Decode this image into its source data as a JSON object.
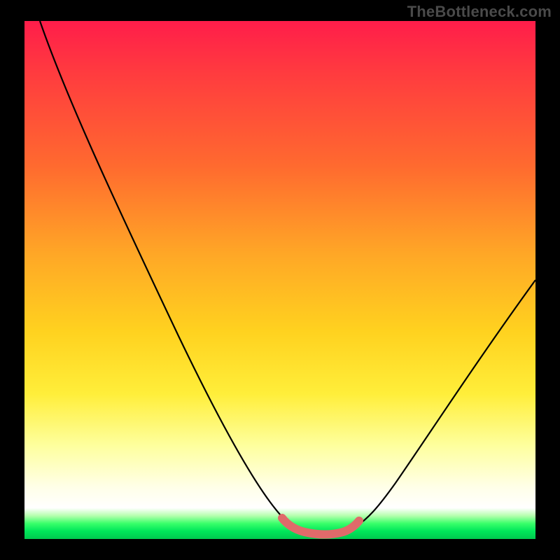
{
  "watermark": "TheBottleneck.com",
  "chart_data": {
    "type": "line",
    "title": "",
    "xlabel": "",
    "ylabel": "",
    "xlim": [
      0,
      100
    ],
    "ylim": [
      0,
      100
    ],
    "grid": false,
    "legend": false,
    "series": [
      {
        "name": "black-curve",
        "color": "#000000",
        "x": [
          3,
          10,
          20,
          30,
          40,
          48,
          52,
          55,
          58,
          61,
          64,
          68,
          75,
          85,
          95,
          100
        ],
        "values": [
          100,
          86,
          67,
          49,
          31,
          16,
          8,
          3,
          1,
          1,
          3,
          8,
          20,
          40,
          58,
          66
        ]
      },
      {
        "name": "pink-floor",
        "color": "#e06a6a",
        "x": [
          52,
          54,
          56,
          58,
          60,
          62,
          64
        ],
        "values": [
          3,
          1,
          0.5,
          0.5,
          0.5,
          1,
          3
        ]
      }
    ],
    "notes": "Axes unlabeled; values are relative estimates (0–100) read from curve shape against the vertical color gradient. The pink series traces the flat basin near the minimum."
  }
}
